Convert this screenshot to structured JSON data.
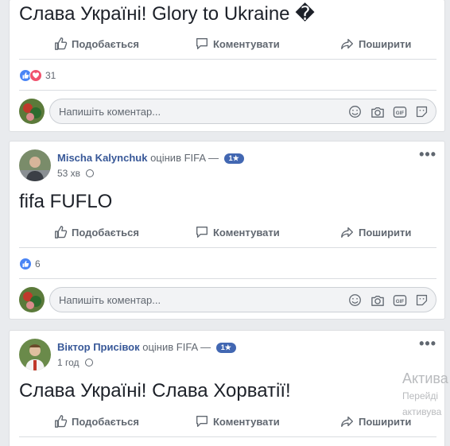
{
  "post1": {
    "text": "Слава Україні! Glory to Ukraine �",
    "actions": {
      "like": "Подобається",
      "comment": "Коментувати",
      "share": "Поширити"
    },
    "reaction_count": "31",
    "comment_placeholder": "Напишіть коментар..."
  },
  "post2": {
    "author": "Mischa Kalynchuk",
    "verb": "оцінив",
    "page": "FIFA —",
    "rating": "1★",
    "time": "53 хв",
    "text": "fifa FUFLO",
    "actions": {
      "like": "Подобається",
      "comment": "Коментувати",
      "share": "Поширити"
    },
    "reaction_count": "6",
    "comment_placeholder": "Напишіть коментар..."
  },
  "post3": {
    "author": "Віктор Присівок",
    "verb": "оцінив",
    "page": "FIFA —",
    "rating": "1★",
    "time": "1 год",
    "text": "Слава Україні! Слава Хорватії!",
    "actions": {
      "like": "Подобається",
      "comment": "Коментувати",
      "share": "Поширити"
    }
  },
  "windows_watermark": {
    "title": "Актива",
    "line1": "Перейді",
    "line2": "активува"
  },
  "colors": {
    "link": "#385898",
    "brand": "#4267b2",
    "like": "#4a85f5",
    "love": "#f0526d"
  }
}
